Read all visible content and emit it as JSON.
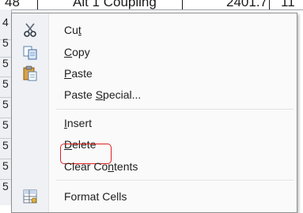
{
  "spreadsheet": {
    "top_row_cells": [
      "48",
      "Alt 1 Coupling",
      "2401.7",
      "11"
    ],
    "row_numbers": [
      "4",
      "5",
      "5",
      "5",
      "5",
      "5",
      "5",
      "5",
      "5"
    ]
  },
  "context_menu": {
    "items": {
      "cut": {
        "pre": "Cu",
        "accel": "t",
        "post": "",
        "icon": "scissors-icon"
      },
      "copy": {
        "pre": "",
        "accel": "C",
        "post": "opy",
        "icon": "copy-icon"
      },
      "paste": {
        "pre": "",
        "accel": "P",
        "post": "aste",
        "icon": "paste-icon"
      },
      "paste_special": {
        "pre": "Paste ",
        "accel": "S",
        "post": "pecial...",
        "icon": ""
      },
      "insert": {
        "pre": "",
        "accel": "I",
        "post": "nsert",
        "icon": ""
      },
      "delete": {
        "pre": "",
        "accel": "D",
        "post": "elete",
        "icon": "",
        "highlighted": true
      },
      "clear_contents": {
        "pre": "Clear Co",
        "accel": "n",
        "post": "tents",
        "icon": ""
      },
      "format_cells": {
        "pre": "Format Cells",
        "accel": "",
        "post": "",
        "icon": "format-cells-icon"
      }
    },
    "colors": {
      "highlight_border": "#e02020",
      "gutter": "#eff1f4"
    }
  }
}
